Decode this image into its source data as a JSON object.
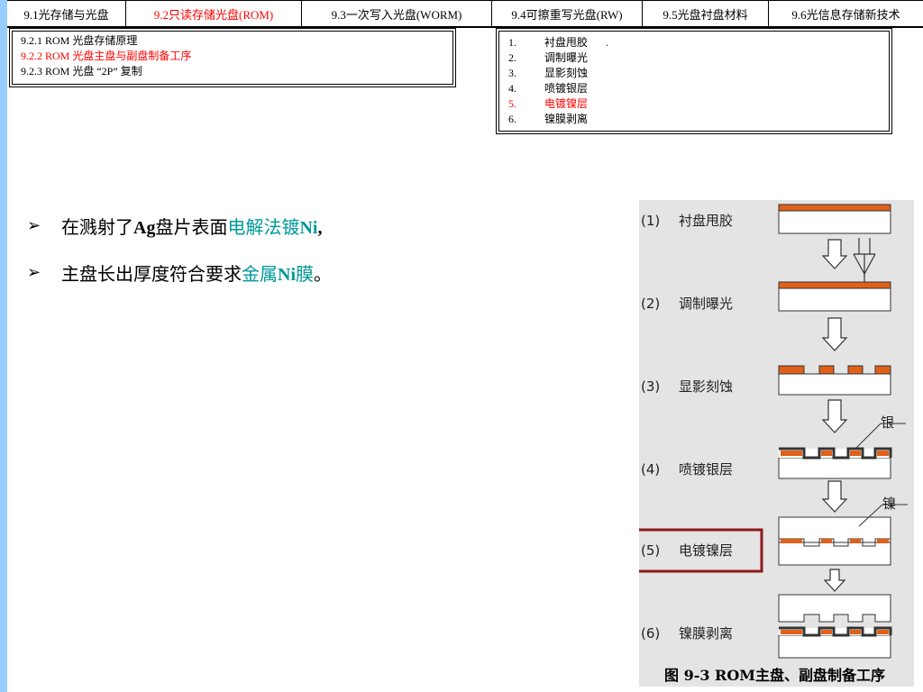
{
  "nav": {
    "tabs": [
      {
        "label": "9.1光存储与光盘"
      },
      {
        "label": "9.2只读存储光盘(ROM)"
      },
      {
        "label": "9.3一次写入光盘(WORM)"
      },
      {
        "label": "9.4可擦重写光盘(RW)"
      },
      {
        "label": "9.5光盘衬盘材料"
      },
      {
        "label": "9.6光信息存储新技术"
      }
    ],
    "active_index": 1
  },
  "submenu": {
    "items": [
      {
        "label": "9.2.1 ROM 光盘存储原理"
      },
      {
        "label": "9.2.2 ROM 光盘主盘与副盘制备工序"
      },
      {
        "label": "9.2.3 ROM 光盘 “2P” 复制"
      }
    ],
    "active_index": 1
  },
  "steps": {
    "items": [
      {
        "num": "1.",
        "label": "衬盘甩胶",
        "extra": "."
      },
      {
        "num": "2.",
        "label": "调制曝光",
        "extra": ""
      },
      {
        "num": "3.",
        "label": "显影刻蚀",
        "extra": ""
      },
      {
        "num": "4.",
        "label": "喷镀银层",
        "extra": ""
      },
      {
        "num": "5.",
        "label": "电镀镍层",
        "extra": ""
      },
      {
        "num": "6.",
        "label": "镍膜剥离",
        "extra": ""
      }
    ],
    "active_index": 4
  },
  "content": {
    "bullet1": {
      "prefix": "在溅射了",
      "bold": "Ag",
      "mid": "盘片表面",
      "hl1": "电解法镀",
      "hl2": "Ni",
      "suffix": ","
    },
    "bullet2": {
      "prefix": "主盘长出厚度符合要求",
      "hl1": "金属",
      "hl2": "Ni",
      "hl3": "膜",
      "suffix": "。"
    }
  },
  "figure": {
    "steps": [
      {
        "num": "(1)",
        "label": "衬盘甩胶"
      },
      {
        "num": "(2)",
        "label": "调制曝光"
      },
      {
        "num": "(3)",
        "label": "显影刻蚀"
      },
      {
        "num": "(4)",
        "label": "喷镀银层"
      },
      {
        "num": "(5)",
        "label": "电镀镍层"
      },
      {
        "num": "(6)",
        "label": "镍膜剥离"
      }
    ],
    "silver_label": "银",
    "nickel_label": "镍",
    "caption": "图 9-3 ROM主盘、副盘制备工序",
    "highlight_index": 4
  },
  "colors": {
    "accent_red": "#ff0000",
    "highlight_teal": "#009999",
    "layer_orange": "#e0601a",
    "box_dark_red": "#8b1a1a",
    "side_bar": "#99ccff"
  }
}
